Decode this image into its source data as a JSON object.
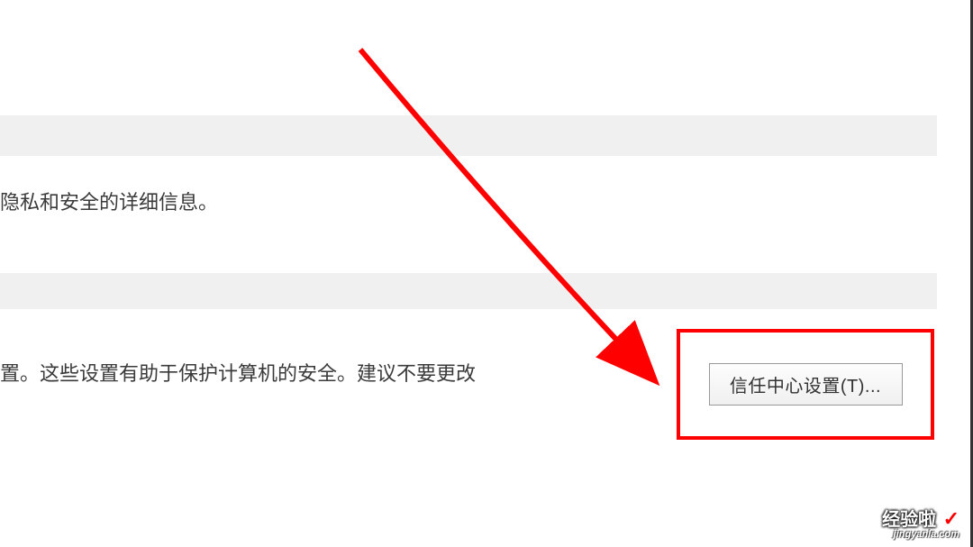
{
  "section1": {
    "description": "隐私和安全的详细信息。"
  },
  "section2": {
    "description": "置。这些设置有助于保护计算机的安全。建议不要更改"
  },
  "buttons": {
    "trust_center_settings": "信任中心设置(T)..."
  },
  "watermark": {
    "main": "经验啦",
    "check": "✓",
    "sub": "jingyanla.com"
  }
}
